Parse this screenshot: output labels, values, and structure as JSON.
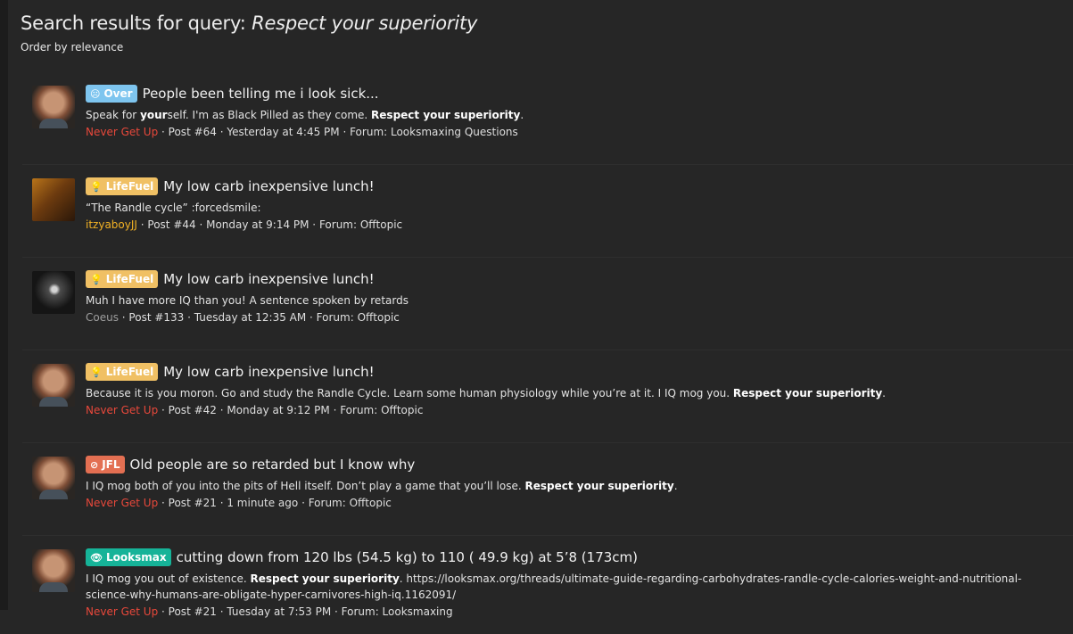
{
  "header": {
    "title_prefix": "Search results for query:",
    "query": "Respect your superiority",
    "order": "Order by relevance"
  },
  "results": [
    {
      "badge": {
        "label": "Over",
        "icon": "frown-icon",
        "color": "#7ec5ef"
      },
      "title": "People been telling me i look sick...",
      "snippet_parts": [
        "Speak for ",
        "your",
        "self. I'm as Black Pilled as they come. ",
        "Respect your superiority",
        "."
      ],
      "user": "Never Get Up",
      "meta": "· Post #64 · Yesterday at 4:45 PM · Forum: Looksmaxing Questions"
    },
    {
      "badge": {
        "label": "LifeFuel",
        "icon": "lightbulb-icon",
        "color": "#f0c064"
      },
      "title": "My low carb inexpensive lunch!",
      "snippet": "“The Randle cycle” :forcedsmile:",
      "user": "itzyaboyJJ",
      "meta": "· Post #44 · Monday at 9:14 PM · Forum: Offtopic"
    },
    {
      "badge": {
        "label": "LifeFuel",
        "icon": "lightbulb-icon",
        "color": "#f0c064"
      },
      "title": "My low carb inexpensive lunch!",
      "snippet": "Muh I have more IQ than you! A sentence spoken by retards",
      "user": "Coeus",
      "meta": "· Post #133 · Tuesday at 12:35 AM · Forum: Offtopic"
    },
    {
      "badge": {
        "label": "LifeFuel",
        "icon": "lightbulb-icon",
        "color": "#f0c064"
      },
      "title": "My low carb inexpensive lunch!",
      "snippet_parts": [
        "Because it is you moron. Go and study the Randle Cycle. Learn some human physiology while you’re at it. I IQ mog you. ",
        "Respect your superiority",
        "."
      ],
      "user": "Never Get Up",
      "meta": "· Post #42 · Monday at 9:12 PM · Forum: Offtopic"
    },
    {
      "badge": {
        "label": "JFL",
        "icon": "jfl-icon",
        "color": "#e36f52"
      },
      "title": "Old people are so retarded but I know why",
      "snippet_parts": [
        "I IQ mog both of you into the pits of Hell itself. Don’t play a game that you’ll lose. ",
        "Respect your superiority",
        "."
      ],
      "user": "Never Get Up",
      "meta": "· Post #21 · 1 minute ago · Forum: Offtopic"
    },
    {
      "badge": {
        "label": "Looksmax",
        "icon": "eye-icon",
        "color": "#16b398"
      },
      "title": "cutting down from 120 lbs (54.5 kg) to 110 ( 49.9 kg) at 5’8 (173cm)",
      "snippet_parts": [
        "I IQ mog you out of existence. ",
        "Respect your superiority",
        ". https://looksmax.org/threads/ultimate-guide-regarding-carbohydrates-randle-cycle-calories-weight-and-nutritional-science-why-humans-are-obligate-hyper-carnivores-high-iq.1162091/"
      ],
      "user": "Never Get Up",
      "meta": "· Post #21 · Tuesday at 7:53 PM · Forum: Looksmaxing"
    }
  ]
}
